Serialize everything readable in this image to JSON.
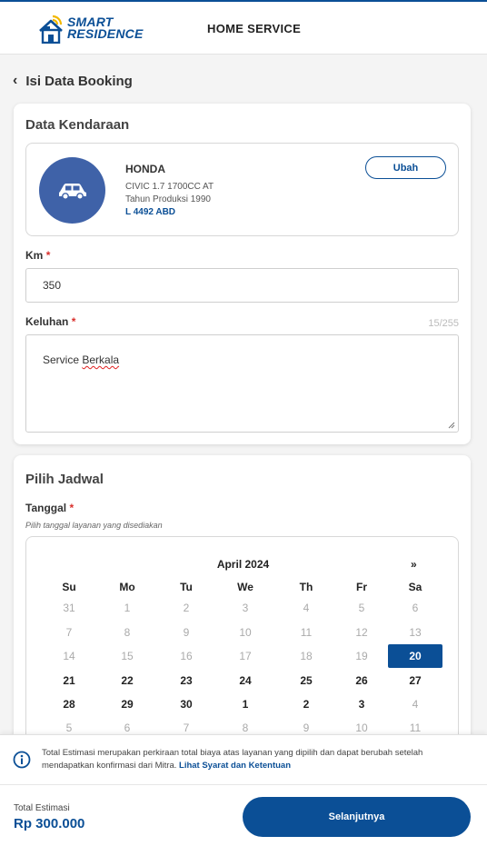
{
  "header": {
    "logo_line1": "SMART",
    "logo_line2": "RESIDENCE",
    "title": "HOME SERVICE"
  },
  "page": {
    "back_title": "Isi Data Booking"
  },
  "vehicle_card": {
    "title": "Data Kendaraan",
    "brand": "HONDA",
    "model": "CIVIC 1.7 1700CC AT",
    "year": "Tahun Produksi 1990",
    "plate": "L 4492 ABD",
    "change_label": "Ubah",
    "km_label": "Km",
    "km_value": "350",
    "complaint_label": "Keluhan",
    "complaint_counter": "15/255",
    "complaint_value_word1": "Service",
    "complaint_value_word2": "Berkala",
    "required_mark": "*"
  },
  "schedule_card": {
    "title": "Pilih Jadwal",
    "date_label": "Tanggal",
    "date_hint": "Pilih tanggal layanan yang disediakan",
    "required_mark": "*"
  },
  "calendar": {
    "month": "April 2024",
    "next": "»",
    "weekdays": [
      "Su",
      "Mo",
      "Tu",
      "We",
      "Th",
      "Fr",
      "Sa"
    ],
    "weeks": [
      [
        {
          "d": "31",
          "m": true
        },
        {
          "d": "1",
          "m": true
        },
        {
          "d": "2",
          "m": true
        },
        {
          "d": "3",
          "m": true
        },
        {
          "d": "4",
          "m": true
        },
        {
          "d": "5",
          "m": true
        },
        {
          "d": "6",
          "m": true
        }
      ],
      [
        {
          "d": "7",
          "m": true
        },
        {
          "d": "8",
          "m": true
        },
        {
          "d": "9",
          "m": true
        },
        {
          "d": "10",
          "m": true
        },
        {
          "d": "11",
          "m": true
        },
        {
          "d": "12",
          "m": true
        },
        {
          "d": "13",
          "m": true
        }
      ],
      [
        {
          "d": "14",
          "m": true
        },
        {
          "d": "15",
          "m": true
        },
        {
          "d": "16",
          "m": true
        },
        {
          "d": "17",
          "m": true
        },
        {
          "d": "18",
          "m": true
        },
        {
          "d": "19",
          "m": true
        },
        {
          "d": "20",
          "m": false,
          "sel": true
        }
      ],
      [
        {
          "d": "21",
          "m": false
        },
        {
          "d": "22",
          "m": false
        },
        {
          "d": "23",
          "m": false
        },
        {
          "d": "24",
          "m": false
        },
        {
          "d": "25",
          "m": false
        },
        {
          "d": "26",
          "m": false
        },
        {
          "d": "27",
          "m": false
        }
      ],
      [
        {
          "d": "28",
          "m": false
        },
        {
          "d": "29",
          "m": false
        },
        {
          "d": "30",
          "m": false
        },
        {
          "d": "1",
          "m": false
        },
        {
          "d": "2",
          "m": false
        },
        {
          "d": "3",
          "m": false
        },
        {
          "d": "4",
          "m": true
        }
      ],
      [
        {
          "d": "5",
          "m": true
        },
        {
          "d": "6",
          "m": true
        },
        {
          "d": "7",
          "m": true
        },
        {
          "d": "8",
          "m": true
        },
        {
          "d": "9",
          "m": true
        },
        {
          "d": "10",
          "m": true
        },
        {
          "d": "11",
          "m": true
        }
      ]
    ]
  },
  "footer": {
    "info_text": "Total Estimasi merupakan perkiraan total biaya atas layanan yang dipilih dan dapat berubah setelah mendapatkan konfirmasi dari Mitra.",
    "info_link": "Lihat Syarat dan Ketentuan",
    "total_label": "Total Estimasi",
    "total_value": "Rp 300.000",
    "next_label": "Selanjutnya"
  },
  "colors": {
    "primary": "#0b4f96",
    "avatar": "#3f62a8",
    "required": "#d9302c"
  }
}
